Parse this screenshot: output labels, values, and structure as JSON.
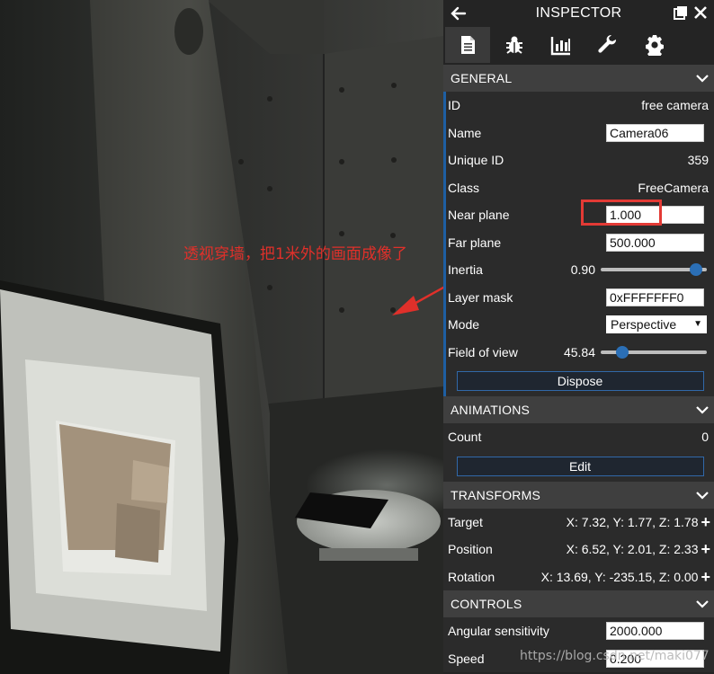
{
  "annotation": "透视穿墙，把1米外的画面成像了",
  "watermark": "https://blog.csdn.net/maki077",
  "inspector": {
    "title": "INSPECTOR",
    "icons": {
      "back": "arrow-left-icon",
      "popout": "popout-icon",
      "close": "close-icon"
    },
    "tabs": [
      {
        "name": "properties",
        "icon": "document-icon",
        "active": true
      },
      {
        "name": "debug",
        "icon": "bug-icon",
        "active": false
      },
      {
        "name": "statistics",
        "icon": "bar-chart-icon",
        "active": false
      },
      {
        "name": "tools",
        "icon": "wrench-icon",
        "active": false
      },
      {
        "name": "settings",
        "icon": "gear-icon",
        "active": false
      }
    ],
    "general": {
      "header": "GENERAL",
      "id_label": "ID",
      "id_value": "free camera",
      "name_label": "Name",
      "name_value": "Camera06",
      "uid_label": "Unique ID",
      "uid_value": "359",
      "class_label": "Class",
      "class_value": "FreeCamera",
      "near_label": "Near plane",
      "near_value": "1.000",
      "far_label": "Far plane",
      "far_value": "500.000",
      "inertia_label": "Inertia",
      "inertia_value": "0.90",
      "inertia_fraction": 0.9,
      "layer_label": "Layer mask",
      "layer_value": "0xFFFFFFF0",
      "mode_label": "Mode",
      "mode_value": "Perspective",
      "fov_label": "Field of view",
      "fov_value": "45.84",
      "fov_fraction": 0.2,
      "dispose_label": "Dispose"
    },
    "animations": {
      "header": "ANIMATIONS",
      "count_label": "Count",
      "count_value": "0",
      "edit_label": "Edit"
    },
    "transforms": {
      "header": "TRANSFORMS",
      "target_label": "Target",
      "target_value": "X: 7.32, Y: 1.77, Z: 1.78",
      "position_label": "Position",
      "position_value": "X: 6.52, Y: 2.01, Z: 2.33",
      "rotation_label": "Rotation",
      "rotation_value": "X: 13.69, Y: -235.15, Z: 0.00"
    },
    "controls": {
      "header": "CONTROLS",
      "angular_label": "Angular sensitivity",
      "angular_value": "2000.000",
      "speed_label": "Speed",
      "speed_value": "0.200"
    }
  },
  "colors": {
    "accent": "#1e5fa3",
    "highlight": "#e33a35",
    "annotation": "#e0302a"
  }
}
